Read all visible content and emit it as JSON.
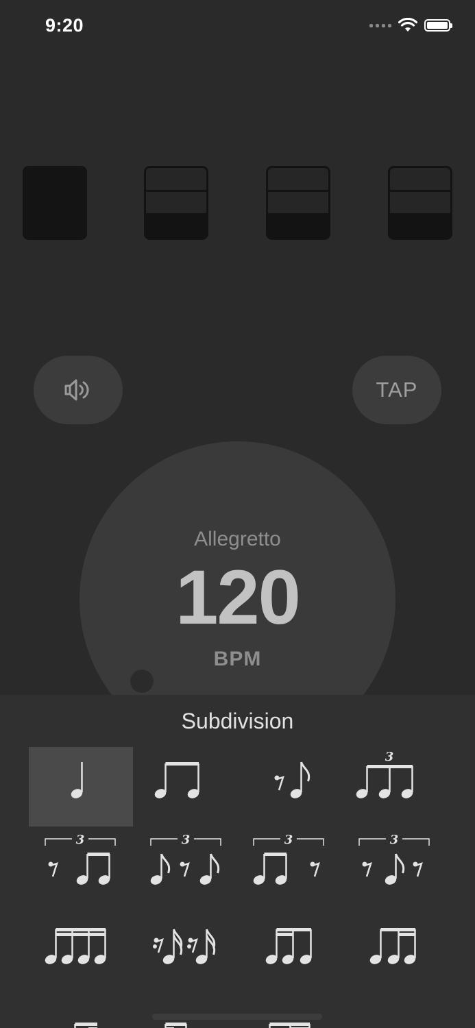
{
  "status": {
    "time": "9:20"
  },
  "beats": [
    "accent",
    "subdivided",
    "subdivided",
    "subdivided"
  ],
  "controls": {
    "sound_icon": "speaker-icon",
    "tap_label": "TAP"
  },
  "tempo": {
    "name": "Allegretto",
    "bpm": "120",
    "unit": "BPM"
  },
  "subdivision": {
    "title": "Subdivision",
    "selected_index": 0,
    "items": [
      "quarter-note-icon",
      "eighth-notes-icon",
      "eighth-rest-eighth-note-icon",
      "eighth-triplet-icon",
      "triplet-rest-two-notes-icon",
      "triplet-note-rest-note-icon",
      "triplet-two-notes-rest-icon",
      "triplet-rest-note-rest-icon",
      "sixteenth-notes-icon",
      "sixteenth-rest-note-pattern-icon",
      "two-sixteenths-eighth-icon",
      "eighth-two-sixteenths-icon",
      "sixteenth-eighth-dotted-icon",
      "mixed-pattern-a-icon",
      "mixed-pattern-b-icon"
    ],
    "triplet_number": "3"
  },
  "colors": {
    "background": "#2a2a2a",
    "sheet": "#303030",
    "selected": "#4a4a4a",
    "beat_fill": "#141414"
  }
}
